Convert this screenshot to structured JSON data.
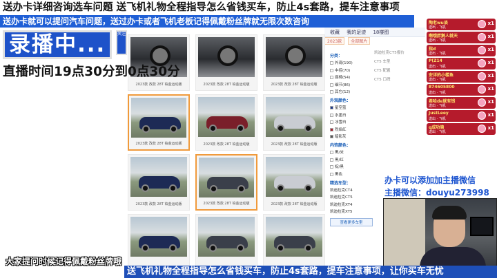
{
  "banners": {
    "top": "送办卡详细咨询选车问题  送飞机礼物全程指导怎么省钱买车，防止4s套路，提车注意事项",
    "sub": "送办卡就可以提问汽车问题，送过办卡或者飞机老板记得佩戴粉丝牌就无限次数咨询",
    "bottom": "送飞机礼物全程指导怎么省钱买车，防止4s套路，提车注意事项，让你买车无忧"
  },
  "overlay": {
    "rec_label": "录播中...",
    "schedule": "直播时间19点30分到0点30分",
    "hint": "大家提问时候记得佩戴粉丝牌哦",
    "wechat_line1": "办卡可以添加加主播微信",
    "wechat_line2": "主播微信：douyu273998",
    "side_badge": "关注"
  },
  "gift_feed": [
    {
      "nick": "陶老wu谈",
      "action": "送出 · 飞机",
      "count": "x1"
    },
    {
      "nick": "啊哦胖鹅人就天",
      "action": "送出 · 飞机",
      "count": "x1"
    },
    {
      "nick": "指d",
      "action": "送出 · 飞机",
      "count": "x1"
    },
    {
      "nick": "P(Z14",
      "action": "送出 · 飞机",
      "count": "x1"
    },
    {
      "nick": "安详的小楼鱼",
      "action": "送出 · 飞机",
      "count": "x1"
    },
    {
      "nick": "874605800",
      "action": "送出 · 飞机",
      "count": "x1"
    },
    {
      "nick": "君哈de就有钱",
      "action": "送出 · 飞机",
      "count": "x1"
    },
    {
      "nick": "JustLeey",
      "action": "送出 · 飞机",
      "count": "x1"
    },
    {
      "nick": "q成功骑",
      "action": "送出 · 飞机",
      "count": "x1"
    }
  ],
  "webpage": {
    "topbar": [
      "收藏",
      "我的足迹",
      "18楼图"
    ],
    "search_tags": [
      "2023款",
      "全部图片"
    ],
    "gallery_caption": "2023款 改款 28T 铂金运动版",
    "filters": {
      "groups": [
        {
          "title": "分类：",
          "options": [
            "外观(190)",
            "中控(70)",
            "座椅(54)",
            "细节(86)",
            "其它(12)"
          ]
        },
        {
          "title": "外观颜色：",
          "options": [
            "星空蓝",
            "水墨白",
            "冰雪白",
            "烈焰红",
            "暗影灰"
          ]
        },
        {
          "title": "内饰颜色：",
          "options": [
            "黑/米",
            "黑/红",
            "棕/黑",
            "黑色"
          ]
        }
      ],
      "more_title": "精选车型：",
      "more_items": [
        "凯迪拉克CT4",
        "凯迪拉克CT5",
        "凯迪拉克XT4",
        "凯迪拉克XT5"
      ],
      "button": "查看更多车型"
    },
    "list_mid": [
      "凯迪拉克CT5报价",
      "CT5 车型",
      "CT5 配置",
      "CT5 口碑"
    ]
  }
}
